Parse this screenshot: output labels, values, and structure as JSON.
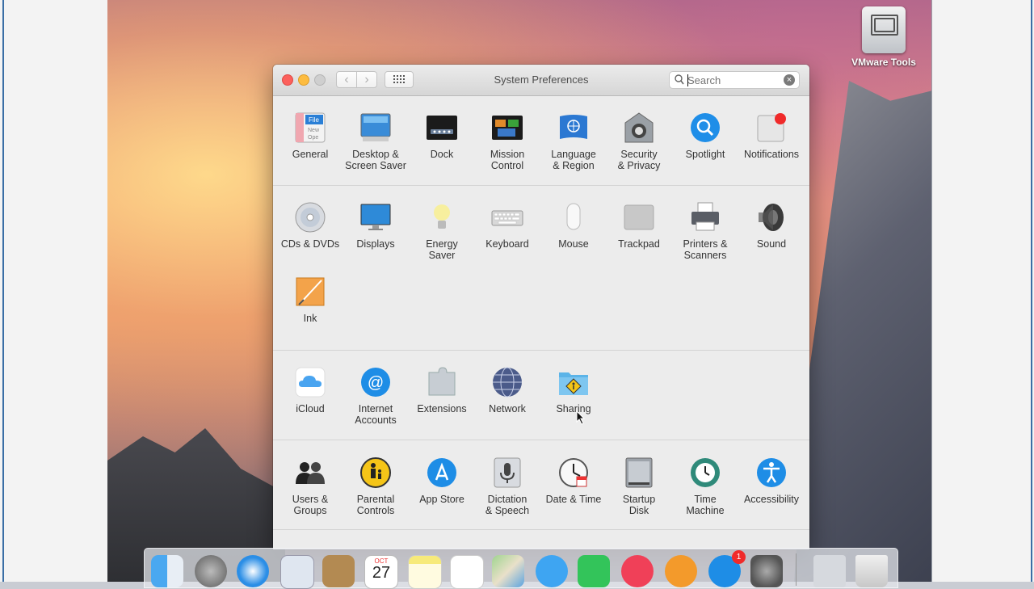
{
  "desktop": {
    "vmware_label": "VMware Tools"
  },
  "window": {
    "title": "System Preferences",
    "search_placeholder": "Search",
    "nav": {
      "back": "‹",
      "forward": "›"
    }
  },
  "sections": [
    {
      "items": [
        {
          "label": "General",
          "icon": "general-icon"
        },
        {
          "label": "Desktop &\nScreen Saver",
          "icon": "desktop-icon"
        },
        {
          "label": "Dock",
          "icon": "dock-icon"
        },
        {
          "label": "Mission\nControl",
          "icon": "mission-control-icon"
        },
        {
          "label": "Language\n& Region",
          "icon": "language-region-icon"
        },
        {
          "label": "Security\n& Privacy",
          "icon": "security-icon"
        },
        {
          "label": "Spotlight",
          "icon": "spotlight-icon"
        },
        {
          "label": "Notifications",
          "icon": "notifications-icon"
        }
      ]
    },
    {
      "items": [
        {
          "label": "CDs & DVDs",
          "icon": "cd-icon"
        },
        {
          "label": "Displays",
          "icon": "displays-icon"
        },
        {
          "label": "Energy\nSaver",
          "icon": "energy-icon"
        },
        {
          "label": "Keyboard",
          "icon": "keyboard-icon"
        },
        {
          "label": "Mouse",
          "icon": "mouse-icon"
        },
        {
          "label": "Trackpad",
          "icon": "trackpad-icon"
        },
        {
          "label": "Printers &\nScanners",
          "icon": "printer-icon"
        },
        {
          "label": "Sound",
          "icon": "sound-icon"
        },
        {
          "label": "Ink",
          "icon": "ink-icon"
        }
      ]
    },
    {
      "items": [
        {
          "label": "iCloud",
          "icon": "icloud-icon"
        },
        {
          "label": "Internet\nAccounts",
          "icon": "internet-accounts-icon"
        },
        {
          "label": "Extensions",
          "icon": "extensions-icon"
        },
        {
          "label": "Network",
          "icon": "network-icon"
        },
        {
          "label": "Sharing",
          "icon": "sharing-icon"
        }
      ]
    },
    {
      "items": [
        {
          "label": "Users &\nGroups",
          "icon": "users-icon"
        },
        {
          "label": "Parental\nControls",
          "icon": "parental-icon"
        },
        {
          "label": "App Store",
          "icon": "appstore-icon"
        },
        {
          "label": "Dictation\n& Speech",
          "icon": "dictation-icon"
        },
        {
          "label": "Date & Time",
          "icon": "datetime-icon"
        },
        {
          "label": "Startup\nDisk",
          "icon": "startup-disk-icon"
        },
        {
          "label": "Time\nMachine",
          "icon": "time-machine-icon"
        },
        {
          "label": "Accessibility",
          "icon": "accessibility-icon"
        }
      ]
    }
  ],
  "dock": {
    "calendar_month": "OCT",
    "calendar_day": "27",
    "appstore_badge": "1",
    "items": [
      "finder-icon",
      "launchpad-icon",
      "safari-icon",
      "mail-icon",
      "contacts-icon",
      "calendar-icon",
      "notes-icon",
      "reminders-icon",
      "maps-icon",
      "messages-icon",
      "facetime-icon",
      "itunes-icon",
      "ibooks-icon",
      "appstore-icon",
      "system-preferences-icon",
      "utility-icon",
      "trash-icon"
    ]
  },
  "colors": {
    "close": "#fc605c",
    "minimize": "#fdbc40",
    "accent": "#1d8ce0"
  }
}
